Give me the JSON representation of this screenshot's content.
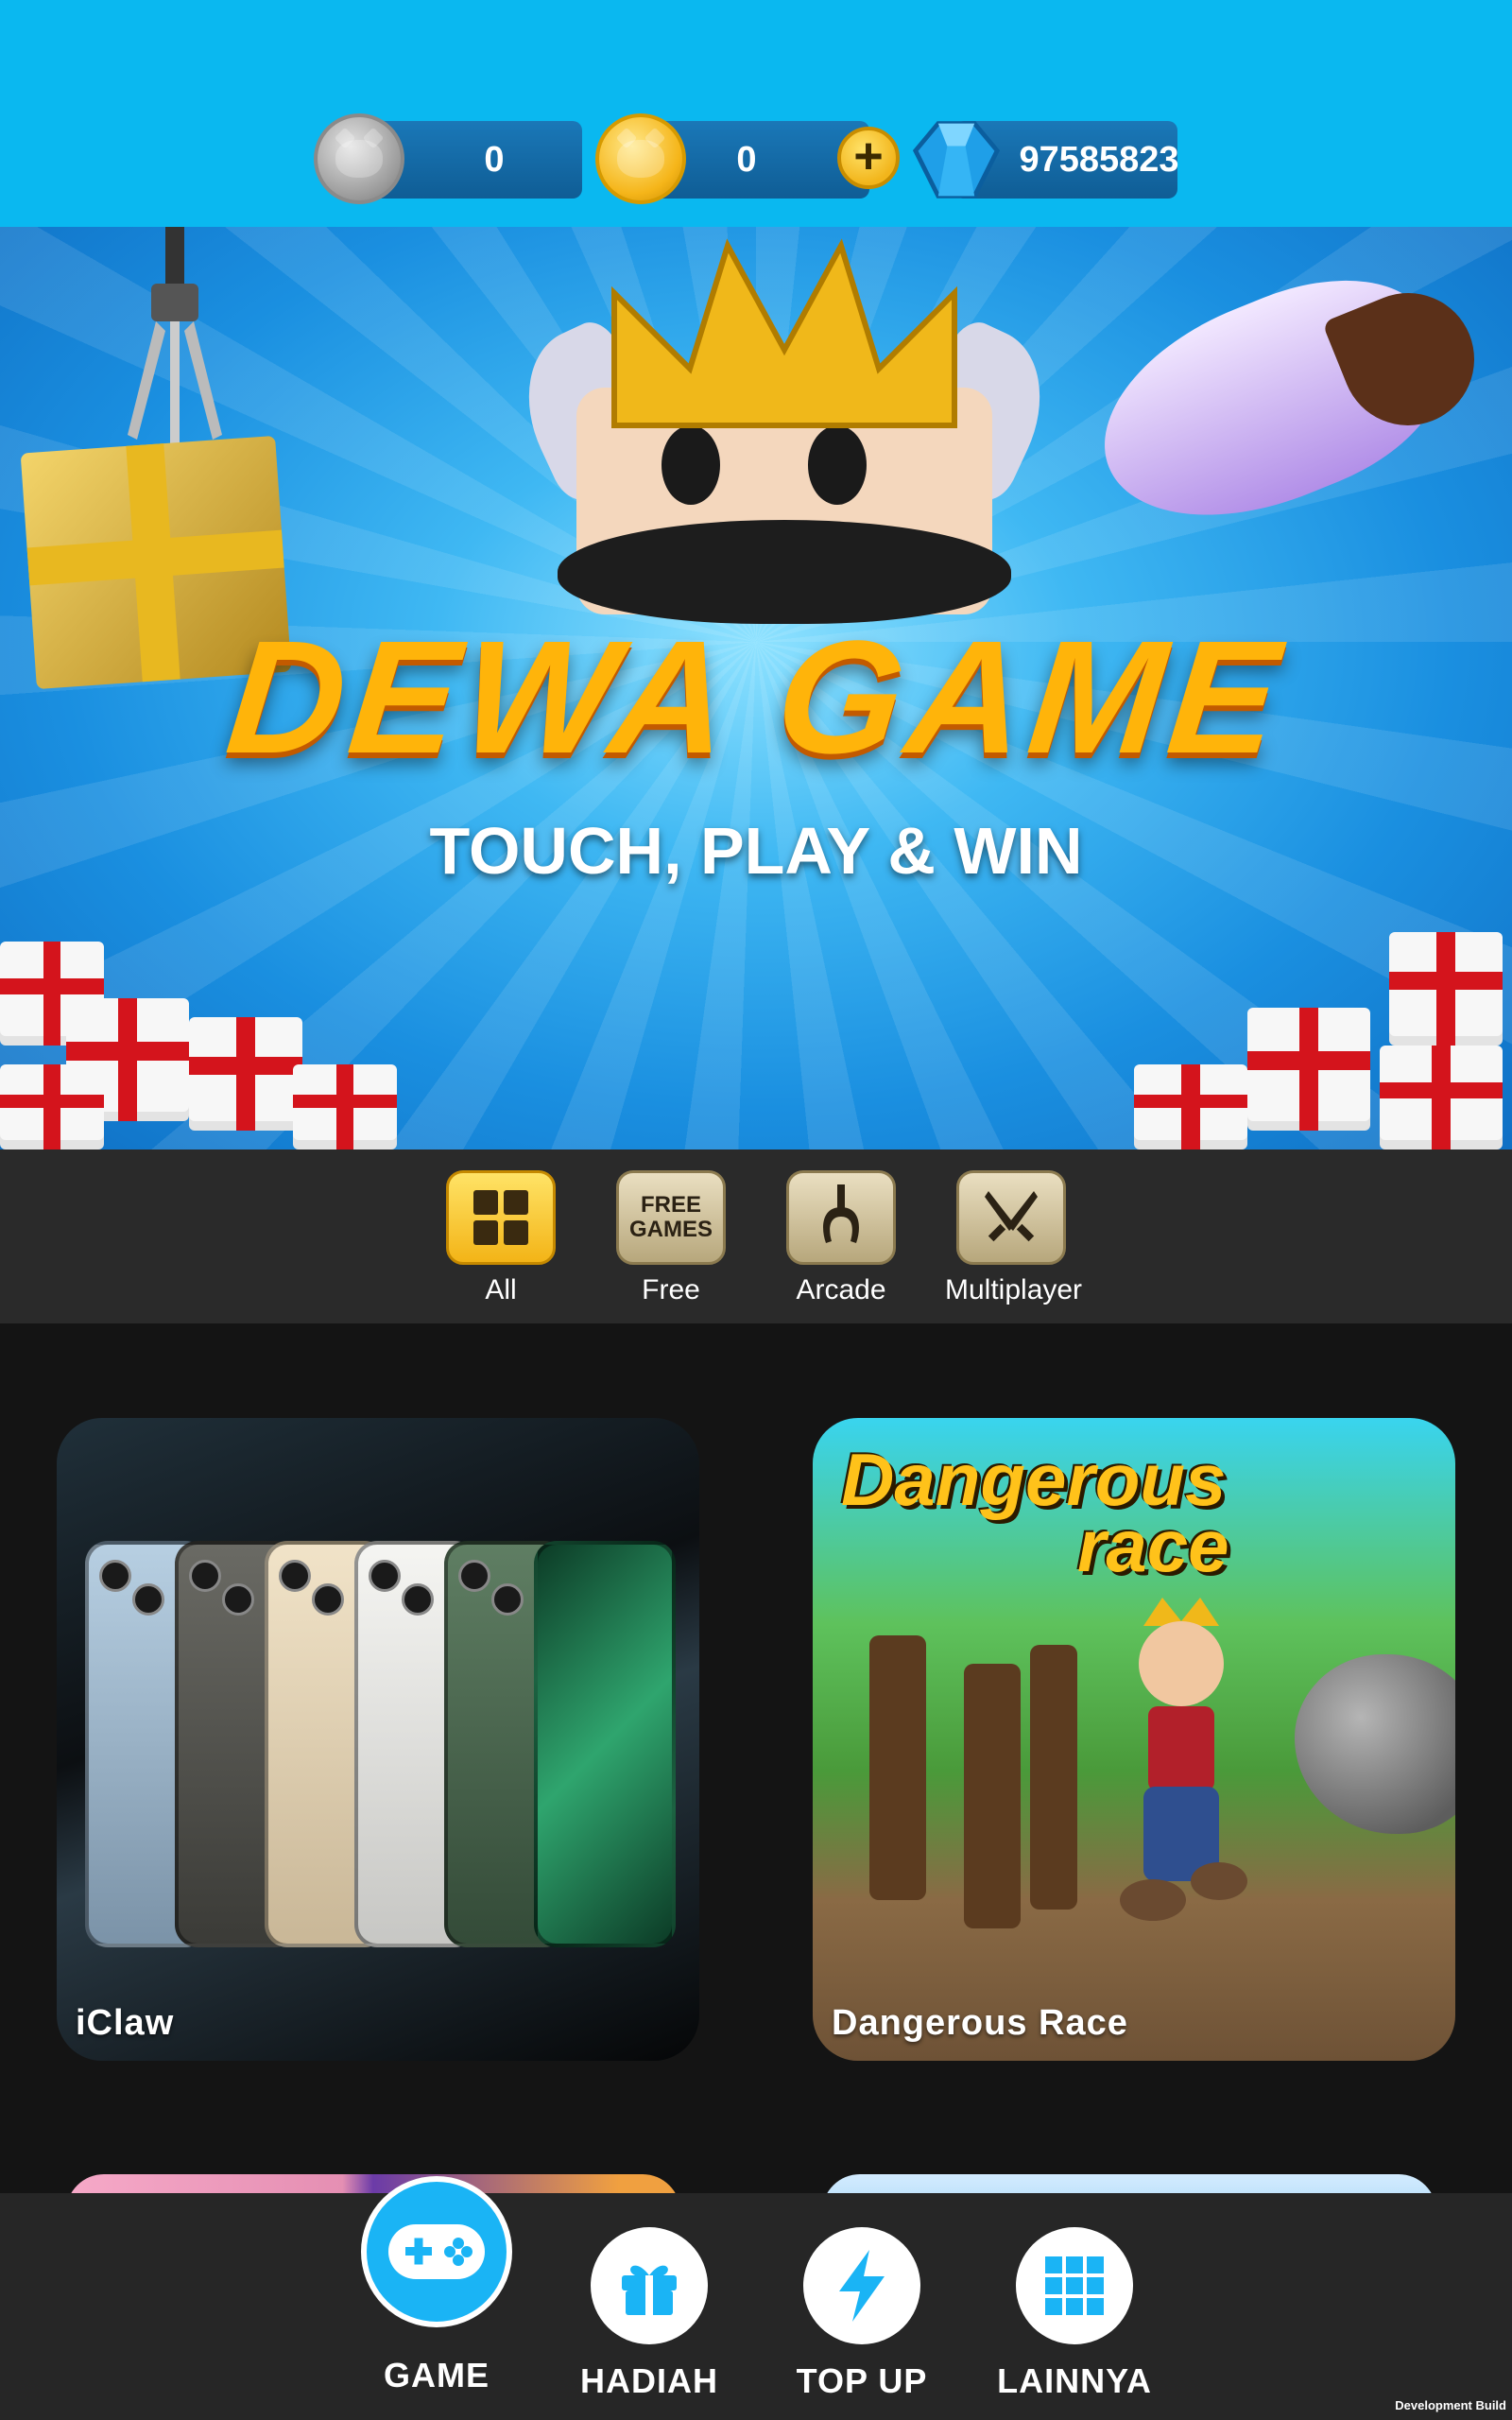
{
  "currencies": {
    "silver_pig_value": "0",
    "gold_pig_value": "0",
    "gems_value": "97585823"
  },
  "banner": {
    "title": "DEWA GAME",
    "subtitle": "TOUCH, PLAY & WIN"
  },
  "categories": [
    {
      "label": "All",
      "icon": "grid-icon",
      "active": true
    },
    {
      "label": "Free",
      "icon": "free-games-icon",
      "icon_text_1": "FREE",
      "icon_text_2": "GAMES"
    },
    {
      "label": "Arcade",
      "icon": "claw-icon"
    },
    {
      "label": "Multiplayer",
      "icon": "crossed-swords-icon"
    }
  ],
  "games": [
    {
      "title": "iClaw"
    },
    {
      "title": "Dangerous Race",
      "logo_line_1": "Dangerous",
      "logo_line_2": "race"
    }
  ],
  "bottom_nav": [
    {
      "label": "GAME",
      "icon": "gamepad-icon",
      "active": true
    },
    {
      "label": "HADIAH",
      "icon": "gift-icon"
    },
    {
      "label": "TOP UP",
      "icon": "lightning-icon"
    },
    {
      "label": "LAINNYA",
      "icon": "apps-grid-icon"
    }
  ],
  "dev_build_label": "Development Build",
  "colors": {
    "header_bg": "#0ab8f0",
    "accent_blue": "#1ab4f5",
    "gold": "#f3b417",
    "nav_bg": "#262626",
    "page_bg": "#141414"
  }
}
